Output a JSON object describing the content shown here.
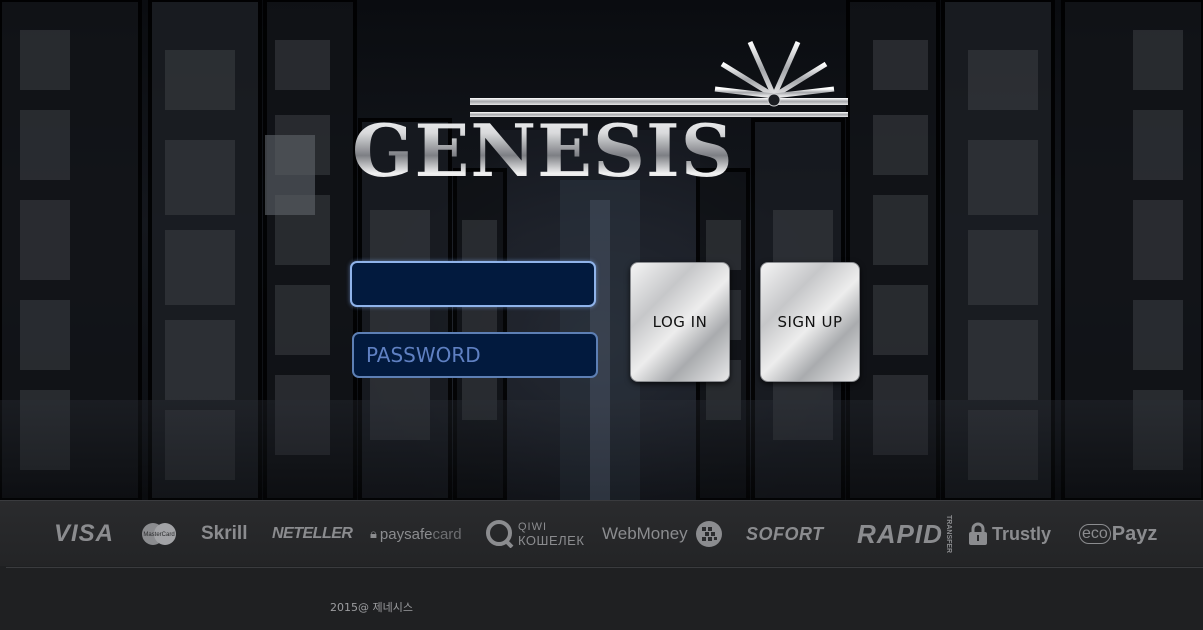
{
  "brand": {
    "logo_text": "GENESIS"
  },
  "login_form": {
    "username_value": "",
    "password_placeholder": "PASSWORD",
    "login_label": "LOG IN",
    "signup_label": "SIGN UP"
  },
  "payment_methods": {
    "visa": "VISA",
    "mastercard": "MasterCard",
    "skrill": "Skrill",
    "neteller": "NETELLER",
    "paysafecard_a": "paysafe",
    "paysafecard_b": "card",
    "qiwi_top": "QIWI",
    "qiwi_bottom": "КОШЕЛЕК",
    "webmoney": "WebMoney",
    "sofort": "SOFORT",
    "rapid": "RAPID",
    "rapid_sub": "TRANSFER",
    "trustly": "Trustly",
    "ecopayz_a": "eco",
    "ecopayz_b": "Payz"
  },
  "footer": {
    "copyright": "2015@ 제네시스"
  },
  "icons": {
    "mastercard": "mastercard-icon",
    "qiwi": "qiwi-icon",
    "webmoney": "globe-icon",
    "trustly": "lock-icon"
  },
  "colors": {
    "field_bg": "#021a3e",
    "field_border": "#5d7fb4",
    "footer_bg": "#1f2022",
    "strip_bg": "#2a2b2d",
    "logo_metal": "#d9dadc"
  }
}
